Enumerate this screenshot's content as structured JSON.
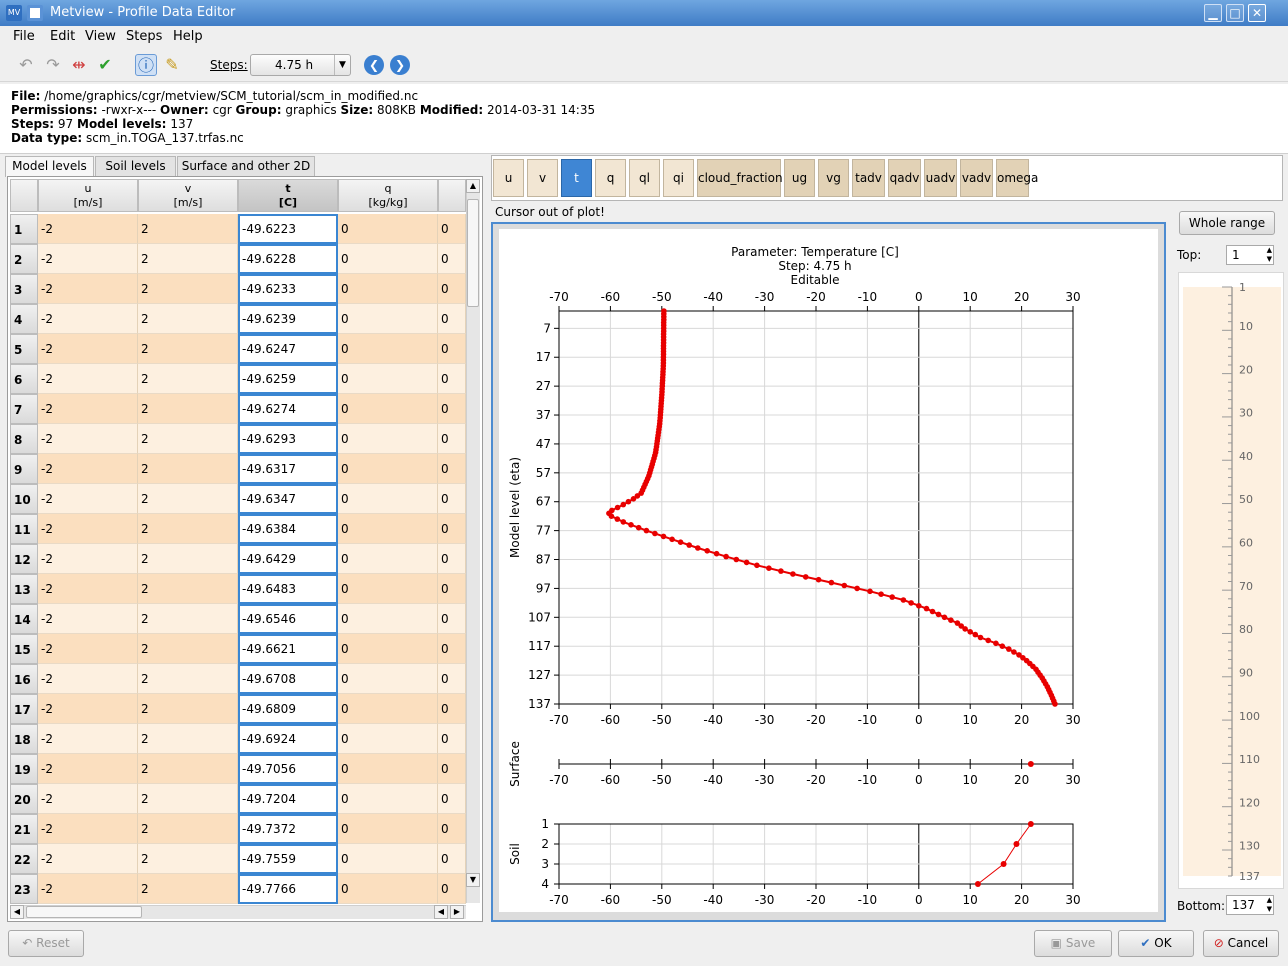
{
  "window": {
    "title": "Metview - Profile Data Editor",
    "app_badge": "MV"
  },
  "menu": [
    "File",
    "Edit",
    "View",
    "Steps",
    "Help"
  ],
  "toolbar": {
    "steps_label": "Steps:",
    "steps_value": "4.75 h"
  },
  "info": {
    "file_label": "File:",
    "file": "/home/graphics/cgr/metview/SCM_tutorial/scm_in_modified.nc",
    "perm_label": "Permissions:",
    "perm": "-rwxr-x---",
    "owner_label": "Owner:",
    "owner": "cgr",
    "group_label": "Group:",
    "group": "graphics",
    "size_label": "Size:",
    "size": "808KB",
    "mod_label": "Modified:",
    "modified": "2014-03-31 14:35",
    "steps_label": "Steps:",
    "steps": "97",
    "levels_label": "Model levels:",
    "levels": "137",
    "dtype_label": "Data type:",
    "dtype": "scm_in.TOGA_137.trfas.nc"
  },
  "tabs": [
    "Model levels",
    "Soil levels",
    "Surface and other 2D"
  ],
  "table": {
    "columns": [
      {
        "name": "u",
        "unit": "[m/s]"
      },
      {
        "name": "v",
        "unit": "[m/s]"
      },
      {
        "name": "t",
        "unit": "[C]"
      },
      {
        "name": "q",
        "unit": "[kg/kg]"
      }
    ],
    "rows": [
      [
        "1",
        "-2",
        "2",
        "-49.6223",
        "0",
        "0"
      ],
      [
        "2",
        "-2",
        "2",
        "-49.6228",
        "0",
        "0"
      ],
      [
        "3",
        "-2",
        "2",
        "-49.6233",
        "0",
        "0"
      ],
      [
        "4",
        "-2",
        "2",
        "-49.6239",
        "0",
        "0"
      ],
      [
        "5",
        "-2",
        "2",
        "-49.6247",
        "0",
        "0"
      ],
      [
        "6",
        "-2",
        "2",
        "-49.6259",
        "0",
        "0"
      ],
      [
        "7",
        "-2",
        "2",
        "-49.6274",
        "0",
        "0"
      ],
      [
        "8",
        "-2",
        "2",
        "-49.6293",
        "0",
        "0"
      ],
      [
        "9",
        "-2",
        "2",
        "-49.6317",
        "0",
        "0"
      ],
      [
        "10",
        "-2",
        "2",
        "-49.6347",
        "0",
        "0"
      ],
      [
        "11",
        "-2",
        "2",
        "-49.6384",
        "0",
        "0"
      ],
      [
        "12",
        "-2",
        "2",
        "-49.6429",
        "0",
        "0"
      ],
      [
        "13",
        "-2",
        "2",
        "-49.6483",
        "0",
        "0"
      ],
      [
        "14",
        "-2",
        "2",
        "-49.6546",
        "0",
        "0"
      ],
      [
        "15",
        "-2",
        "2",
        "-49.6621",
        "0",
        "0"
      ],
      [
        "16",
        "-2",
        "2",
        "-49.6708",
        "0",
        "0"
      ],
      [
        "17",
        "-2",
        "2",
        "-49.6809",
        "0",
        "0"
      ],
      [
        "18",
        "-2",
        "2",
        "-49.6924",
        "0",
        "0"
      ],
      [
        "19",
        "-2",
        "2",
        "-49.7056",
        "0",
        "0"
      ],
      [
        "20",
        "-2",
        "2",
        "-49.7204",
        "0",
        "0"
      ],
      [
        "21",
        "-2",
        "2",
        "-49.7372",
        "0",
        "0"
      ],
      [
        "22",
        "-2",
        "2",
        "-49.7559",
        "0",
        "0"
      ],
      [
        "23",
        "-2",
        "2",
        "-49.7766",
        "0",
        "0"
      ]
    ]
  },
  "params": [
    "u",
    "v",
    "t",
    "q",
    "ql",
    "qi",
    "cloud_fraction",
    "ug",
    "vg",
    "tadv",
    "qadv",
    "uadv",
    "vadv",
    "omega"
  ],
  "selected_param": "t",
  "cursor_status": "Cursor out of plot!",
  "plot": {
    "title1": "Parameter: Temperature [C]",
    "title2": "Step: 4.75 h",
    "title3": "Editable",
    "ylabel": "Model level (eta)",
    "surface_label": "Surface",
    "soil_label": "Soil",
    "xticks": [
      "-70",
      "-60",
      "-50",
      "-40",
      "-30",
      "-20",
      "-10",
      "0",
      "10",
      "20",
      "30"
    ],
    "yticks": [
      "7",
      "17",
      "27",
      "37",
      "47",
      "57",
      "67",
      "77",
      "87",
      "97",
      "107",
      "117",
      "127",
      "137"
    ],
    "soil_ticks": [
      "1",
      "2",
      "3",
      "4"
    ]
  },
  "chart_data": {
    "type": "line",
    "title": "Parameter: Temperature [C]",
    "ylabel": "Model level (eta)",
    "xlim": [
      -70,
      30
    ],
    "ylim": [
      137,
      1
    ],
    "profile": [
      [
        1,
        -49.6
      ],
      [
        20,
        -49.7
      ],
      [
        30,
        -50.0
      ],
      [
        40,
        -50.4
      ],
      [
        50,
        -51.2
      ],
      [
        58,
        -52.5
      ],
      [
        64,
        -54.0
      ],
      [
        66,
        -55.5
      ],
      [
        68,
        -57.5
      ],
      [
        70,
        -59.7
      ],
      [
        71,
        -60.3
      ],
      [
        72,
        -59.8
      ],
      [
        74,
        -57.5
      ],
      [
        77,
        -53.0
      ],
      [
        80,
        -48.0
      ],
      [
        83,
        -43.0
      ],
      [
        86,
        -37.5
      ],
      [
        89,
        -31.5
      ],
      [
        92,
        -24.5
      ],
      [
        95,
        -17.0
      ],
      [
        98,
        -9.5
      ],
      [
        101,
        -3.0
      ],
      [
        104,
        1.5
      ],
      [
        107,
        5.0
      ],
      [
        109,
        7.5
      ],
      [
        111,
        9.0
      ],
      [
        112,
        10.0
      ],
      [
        114,
        12.0
      ],
      [
        116,
        15.0
      ],
      [
        118,
        17.5
      ],
      [
        120,
        19.5
      ],
      [
        122,
        21.0
      ],
      [
        125,
        22.8
      ],
      [
        128,
        24.0
      ],
      [
        131,
        25.0
      ],
      [
        134,
        25.8
      ],
      [
        137,
        26.5
      ]
    ],
    "surface_value": 21.8,
    "soil": [
      [
        1,
        21.8
      ],
      [
        2,
        19.0
      ],
      [
        3,
        16.5
      ],
      [
        4,
        11.5
      ]
    ]
  },
  "levels_panel": {
    "whole_range": "Whole range",
    "top_label": "Top:",
    "top_value": "1",
    "bottom_label": "Bottom:",
    "bottom_value": "137",
    "ticks": [
      "1",
      "10",
      "20",
      "30",
      "40",
      "50",
      "60",
      "70",
      "80",
      "90",
      "100",
      "110",
      "120",
      "130",
      "137"
    ]
  },
  "buttons": {
    "reset": "Reset",
    "save": "Save",
    "ok": "OK",
    "cancel": "Cancel"
  },
  "colors": {
    "accent": "#3f86d4",
    "curve": "#e80000",
    "row_light": "#fdf0e0",
    "row_dark": "#fbdfbf"
  }
}
